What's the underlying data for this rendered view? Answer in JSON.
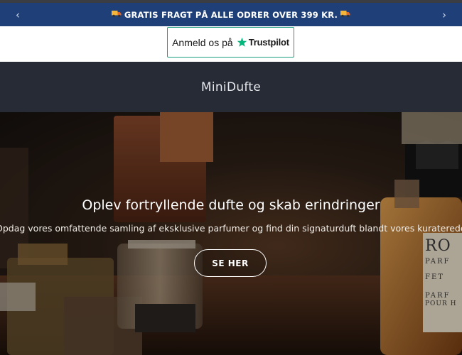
{
  "announcement": {
    "text": "GRATIS FRAGT PÅ ALLE ODRER OVER 399 KR.",
    "prev_arrow": "‹",
    "next_arrow": "›",
    "icon": "truck-icon"
  },
  "trustpilot": {
    "label": "Anmeld os på",
    "brand": "Trustpilot",
    "star_color": "#00b67a",
    "border_color": "#1a9e7e"
  },
  "header": {
    "logo": "MiniDufte",
    "background": "#262b36"
  },
  "hero": {
    "title": "Oplev fortryllende dufte og skab erindringer",
    "subtitle": "Opdag vores omfattende samling af eksklusive parfumer og find din signaturduft blandt vores kuraterede udvalg.",
    "button_label": "SE HER",
    "bottle_labels": {
      "brand_top": "RO",
      "line1": "PARF",
      "line2": "FET",
      "line3": "PARF",
      "line4": "POUR H"
    }
  },
  "colors": {
    "announcement_bg": "#1e3f78",
    "accent_green": "#00b67a"
  }
}
